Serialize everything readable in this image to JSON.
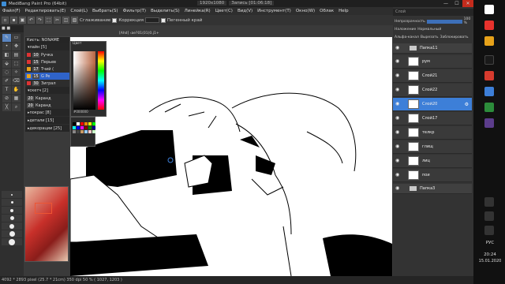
{
  "window": {
    "app_title": "MediBang Paint Pro (64bit)",
    "doc_size": "1920x1080",
    "doc_record": "Запись [01:06:18]",
    "minimize": "—",
    "maximize": "☐",
    "close": "✕"
  },
  "menu": [
    "Файл(F)",
    "Редактировать(E)",
    "Слой(L)",
    "Выбрать(S)",
    "Фильтр(T)",
    "Выделить(S)",
    "Линейка(R)",
    "Цвет(C)",
    "Вид(V)",
    "Инструмент(T)",
    "Окно(W)",
    "Облак",
    "Help"
  ],
  "toolbar": {
    "smoothing_label": "Сглаживание",
    "correction_label": "Коррекция",
    "correction_value": "13",
    "refer_label": "Пегенный край"
  },
  "brush_panel": {
    "title": "Кисть: NONAME",
    "groups": [
      {
        "label": "лайн [5]",
        "items": [
          {
            "num": "10",
            "name": "Ручка",
            "color": "#d33"
          },
          {
            "num": "15",
            "name": "Перьев",
            "color": "#d33"
          },
          {
            "num": "17",
            "name": "Тчий (",
            "color": "#e7a21a"
          },
          {
            "num": "15",
            "name": "G Pe",
            "color": "#3d7fd8",
            "selected": true
          },
          {
            "num": "30",
            "name": "Зиграл",
            "color": "#d33"
          }
        ]
      },
      {
        "label": "скетч [2]",
        "items": [
          {
            "num": "20",
            "name": "Каранд",
            "color": "#888"
          },
          {
            "num": "20",
            "name": "Каранд",
            "color": "#888"
          }
        ]
      }
    ],
    "collapsed_groups": [
      "покрас [8]",
      "детали [15]",
      "декорации [25]"
    ]
  },
  "color_window": {
    "title": "Цвет",
    "hex": "#000000"
  },
  "canvas": {
    "tab_label": "[Ahd] ‹ae?01(01(0.j1+"
  },
  "layers_panel": {
    "search_placeholder": "Слой",
    "opacity_label": "Непрозрачность",
    "opacity_value": "100 %",
    "blend_label": "Наложение",
    "blend_value": "Нормальный",
    "alpha_label": "Альфа-канал",
    "clip_label": "Вырезать",
    "protect_label": "Заблокировать",
    "rows": [
      {
        "type": "folder",
        "name": "Папка11"
      },
      {
        "type": "layer",
        "name": "рум"
      },
      {
        "type": "layer",
        "name": "Слой21"
      },
      {
        "type": "layer",
        "name": "Слой22"
      },
      {
        "type": "layer",
        "name": "Слой20",
        "selected": true
      },
      {
        "type": "layer",
        "name": "Слой17"
      },
      {
        "type": "layer",
        "name": "телкр"
      },
      {
        "type": "layer",
        "name": "глищ"
      },
      {
        "type": "layer",
        "name": "лиц"
      },
      {
        "type": "layer",
        "name": "пои"
      },
      {
        "type": "folder",
        "name": "Папка3"
      }
    ]
  },
  "status": {
    "text": "4092 * 2893 pixel  (25.7 * 21cm)  350 dpi  50 %  ( 1027, 1203 )"
  },
  "taskbar": {
    "lang": "РУС",
    "time": "20:24",
    "date": "15.01.2020"
  },
  "colors": {
    "accent": "#3d7fd8",
    "selected_layer": "#3d7fd8",
    "close_button": "#c42b1c"
  }
}
